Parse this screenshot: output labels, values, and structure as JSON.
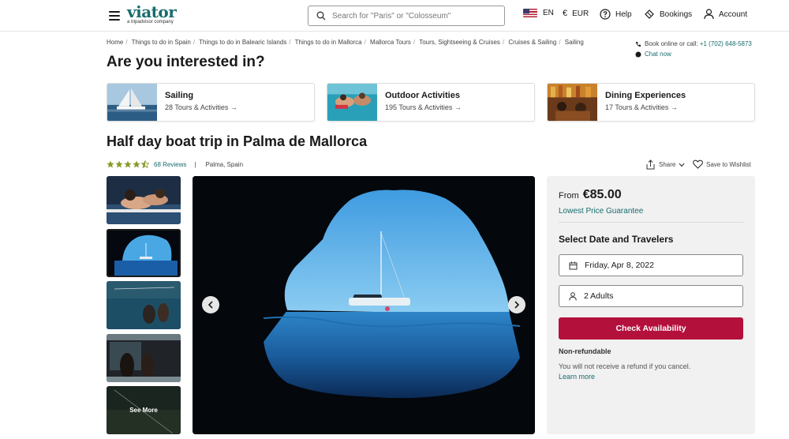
{
  "header": {
    "logo": "viator",
    "logo_sub": "a tripadvisor company",
    "search_placeholder": "Search for \"Paris\" or \"Colosseum\"",
    "language": "EN",
    "currency_symbol": "€",
    "currency": "EUR",
    "help": "Help",
    "bookings": "Bookings",
    "account": "Account"
  },
  "breadcrumbs": [
    "Home",
    "Things to do in Spain",
    "Things to do in Balearic Islands",
    "Things to do in Mallorca",
    "Mallorca Tours",
    "Tours, Sightseeing & Cruises",
    "Cruises & Sailing",
    "Sailing"
  ],
  "contact": {
    "call_prefix": "Book online or call:",
    "phone": "+1 (702) 648-5873",
    "chat": "Chat now"
  },
  "interested": {
    "heading": "Are you interested in?",
    "cards": [
      {
        "title": "Sailing",
        "count": "28 Tours & Activities →"
      },
      {
        "title": "Outdoor Activities",
        "count": "195 Tours & Activities →"
      },
      {
        "title": "Dining Experiences",
        "count": "17 Tours & Activities →"
      }
    ]
  },
  "product": {
    "title": "Half day boat trip in Palma de Mallorca",
    "rating": 4.5,
    "reviews": "68 Reviews",
    "separator": "|",
    "location": "Palma, Spain",
    "share": "Share",
    "wishlist": "Save to Wishlist",
    "see_more": "See More"
  },
  "booking": {
    "from_label": "From",
    "price": "€85.00",
    "lowest_price": "Lowest Price Guarantee",
    "select_title": "Select Date and Travelers",
    "date": "Friday, Apr 8, 2022",
    "travelers": "2 Adults",
    "check_button": "Check Availability",
    "non_refundable": "Non-refundable",
    "refund_text": "You will not receive a refund if you cancel.",
    "learn_more": "Learn more"
  },
  "colors": {
    "brand": "#186b6d",
    "cta": "#b4103c",
    "star": "#8a9a2a"
  }
}
